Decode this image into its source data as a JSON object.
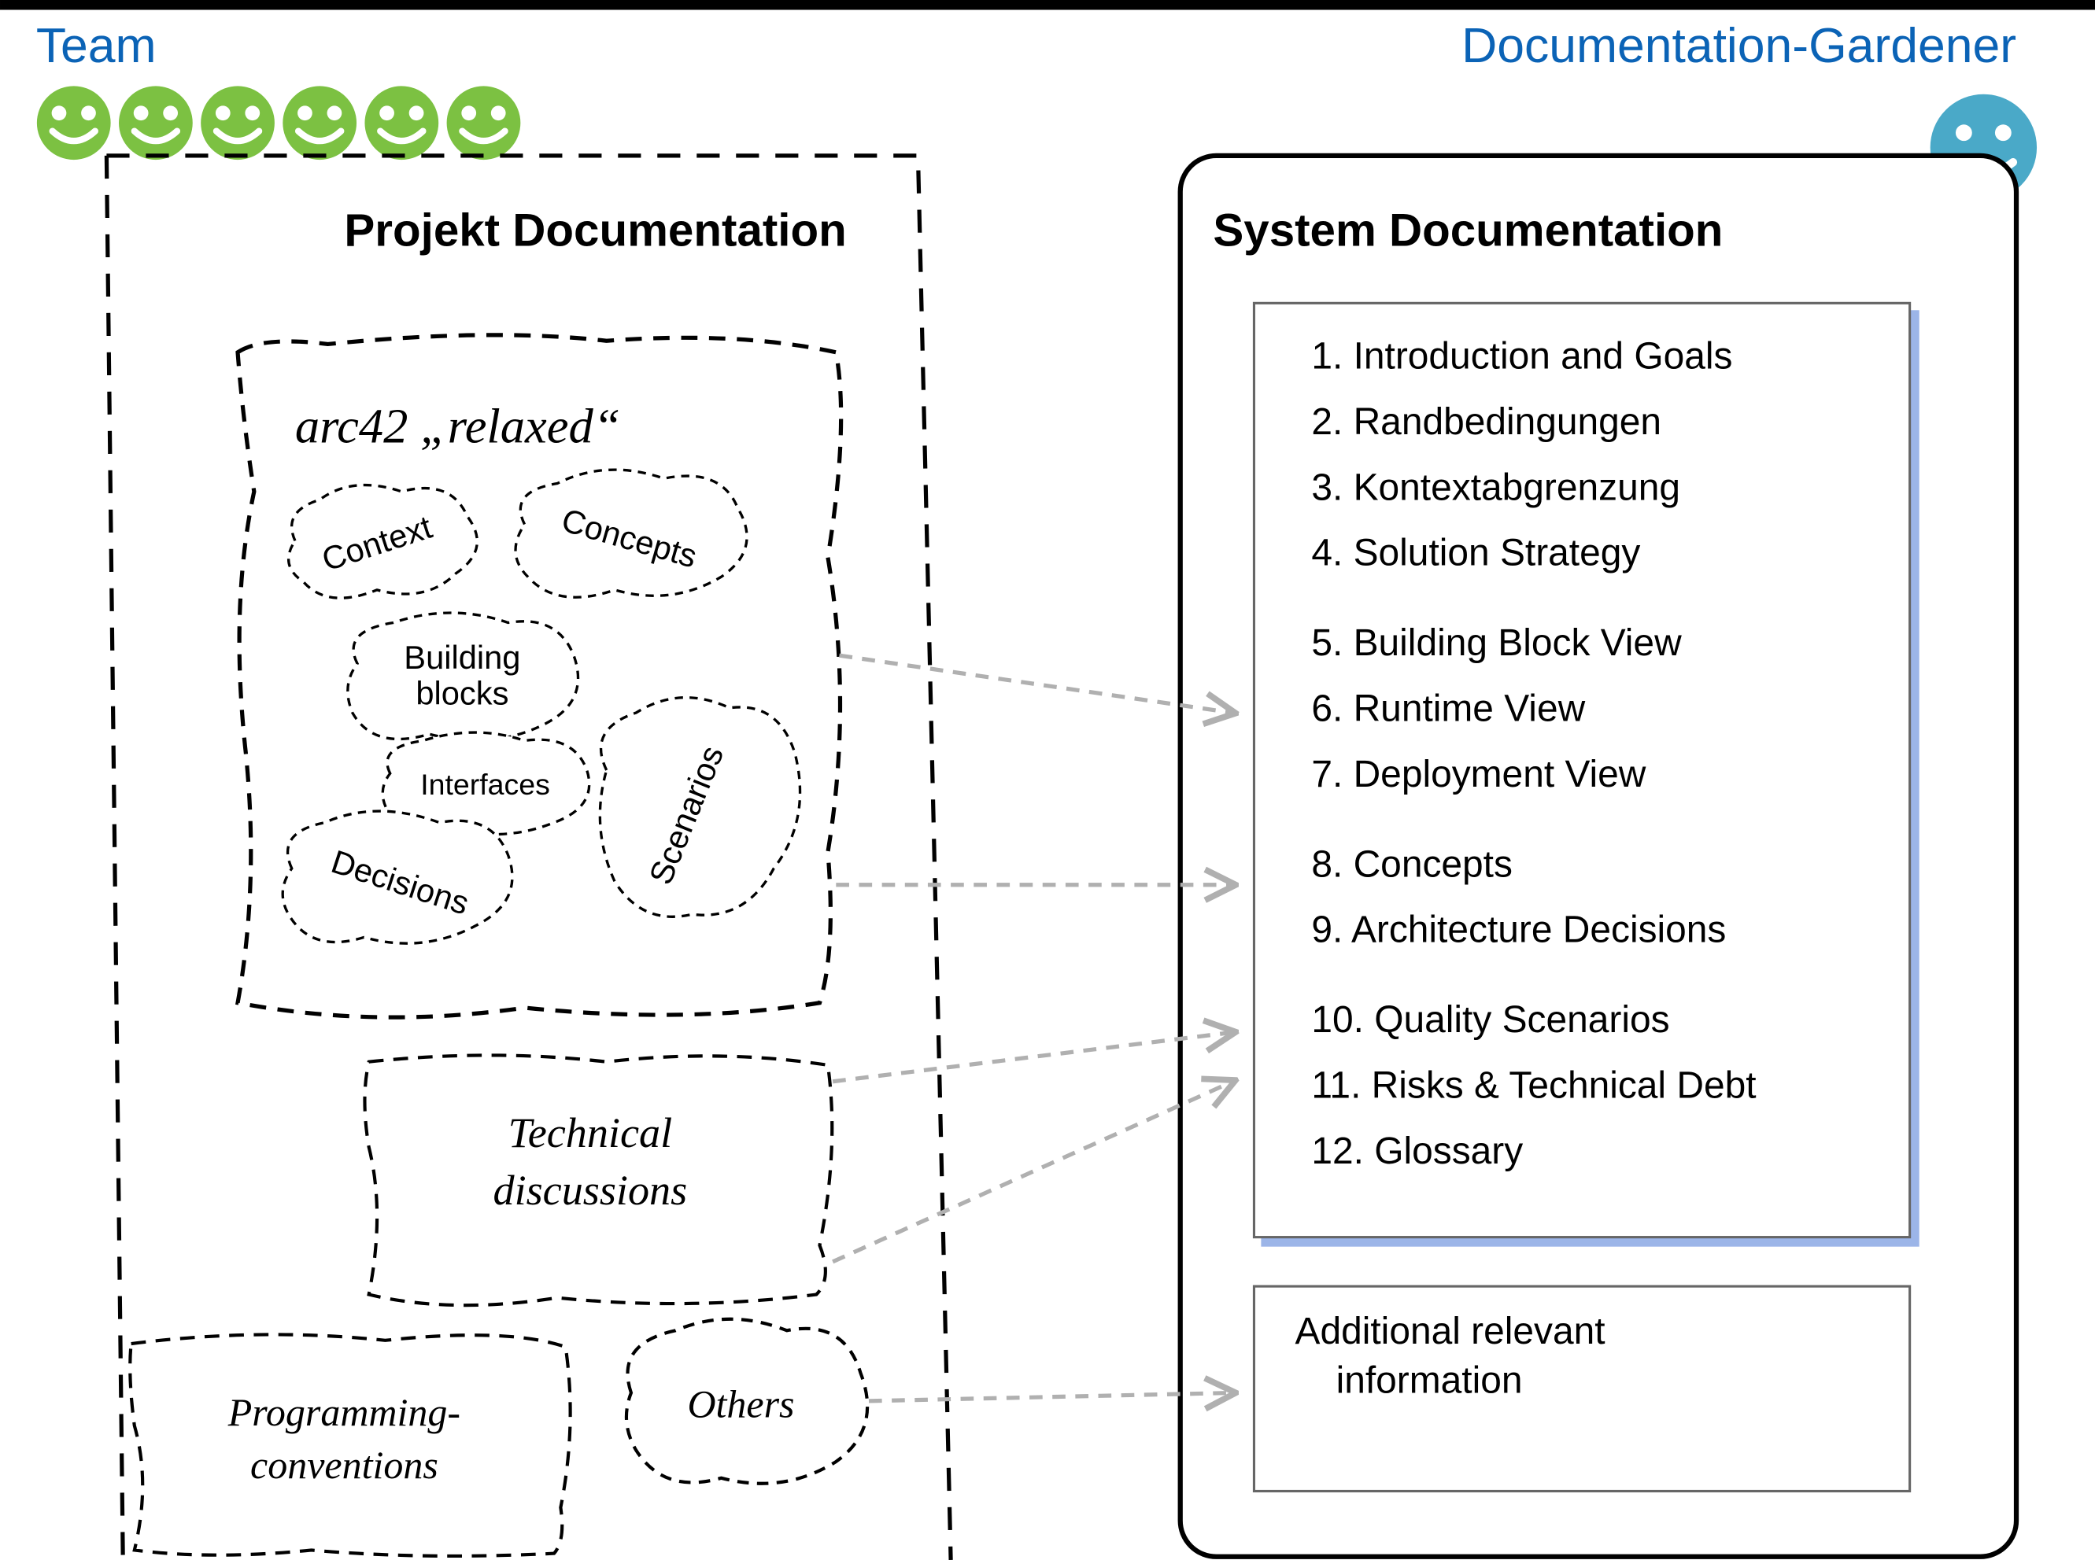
{
  "left": {
    "roleLabel": "Team",
    "boxTitle": "Projekt Documentation",
    "scrap": {
      "title": "arc42 „relaxed“",
      "clouds": {
        "context": "Context",
        "concepts": "Concepts",
        "buildingBlocks": "Building blocks",
        "interfaces": "Interfaces",
        "decisions": "Decisions",
        "scenarios": "Scenarios"
      }
    },
    "extraScraps": {
      "tech": "Technical discussions",
      "conventions": "Programming- conventions",
      "others": "Others"
    }
  },
  "right": {
    "roleLabel": "Documentation-Gardener",
    "boxTitle": "System Documentation",
    "sections": [
      "1. Introduction and Goals",
      "2. Randbedingungen",
      "3. Kontextabgrenzung",
      "4. Solution Strategy",
      "5. Building Block View",
      "6. Runtime View",
      "7. Deployment View",
      "8. Concepts",
      "9. Architecture Decisions",
      "10. Quality Scenarios",
      "11. Risks & Technical Debt",
      "12. Glossary"
    ],
    "additional": "Additional relevant information"
  },
  "colors": {
    "teamGreen": "#7cc142",
    "gardenerTeal": "#4aa9c8",
    "titleBlue": "#0b63b6",
    "arrowGrey": "#b0b0b0",
    "boxShadow": "#4a78d6"
  }
}
